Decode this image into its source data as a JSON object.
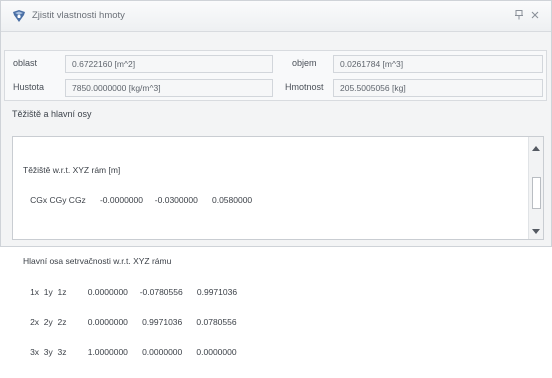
{
  "window": {
    "title": "Zjistit vlastnosti hmoty",
    "title_icon": "mass-properties-icon",
    "pin_icon": "pin-icon",
    "close_icon": "close-icon"
  },
  "properties": {
    "area_label": "oblast",
    "area_value": "0.6722160 [m^2]",
    "volume_label": "objem",
    "volume_value": "0.0261784 [m^3]",
    "density_label": "Hustota",
    "density_value": "7850.0000000 [kg/m^3]",
    "mass_label": "Hmotnost",
    "mass_value": "205.5005056 [kg]"
  },
  "section": {
    "title": "Těžiště a hlavní osy"
  },
  "output": {
    "lines": [
      "Těžiště w.r.t. XYZ rám [m]",
      "   CGx CGy CGz      -0.0000000     -0.0300000      0.0580000",
      "",
      "Hlavní osa setrvačnosti w.r.t. XYZ rámu",
      "   1x  1y  1z         0.0000000     -0.0780556      0.9971036",
      "   2x  2y  2z         0.0000000      0.9971036      0.0780556",
      "   3x  3y  3z         1.0000000      0.0000000      0.0000000"
    ]
  },
  "colors": {
    "accent": "#4a6fa5",
    "panel": "#f3f4f5",
    "border": "#d2d6db"
  }
}
